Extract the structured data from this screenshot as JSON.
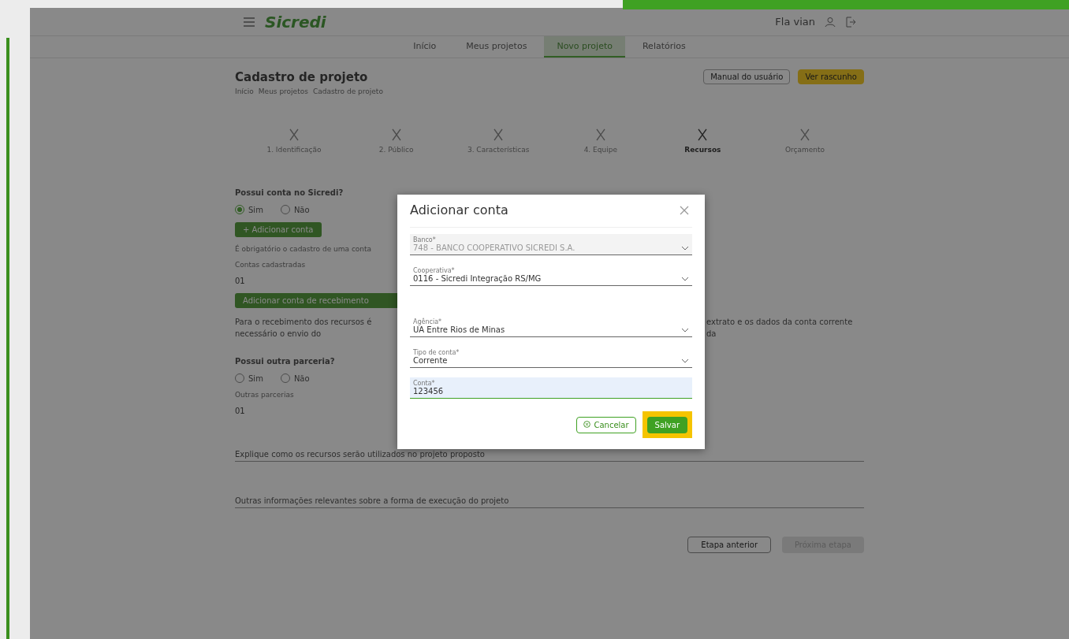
{
  "header": {
    "logo": "Sicredi",
    "user": "Fla vian"
  },
  "nav": [
    {
      "label": "Início",
      "selected": false
    },
    {
      "label": "Meus projetos",
      "selected": false
    },
    {
      "label": "Novo projeto",
      "selected": true
    },
    {
      "label": "Relatórios",
      "selected": false
    }
  ],
  "page": {
    "title": "Cadastro de projeto",
    "breadcrumb": [
      "Início",
      "Meus projetos",
      "Cadastro de projeto"
    ],
    "actions": [
      {
        "label": "Manual do usuário",
        "kind": "outline"
      },
      {
        "label": "Ver rascunho",
        "kind": "highlight"
      }
    ]
  },
  "steps": [
    {
      "label": "1. Identificação",
      "selected": false
    },
    {
      "label": "2. Público",
      "selected": false
    },
    {
      "label": "3. Características",
      "selected": false
    },
    {
      "label": "4. Equipe",
      "selected": false
    },
    {
      "label": "Recursos",
      "selected": true
    },
    {
      "label": "Orçamento",
      "selected": false
    }
  ],
  "form": {
    "question_1": "Possui conta no Sicredi?",
    "radios_1": [
      {
        "label": "Sim",
        "selected": true
      },
      {
        "label": "Não",
        "selected": false
      }
    ],
    "add_button": "+ Adicionar conta",
    "note": "É obrigatório o cadastro de uma conta",
    "field_1": {
      "label": "Contas cadastradas",
      "value": "01"
    },
    "receive_button": "Adicionar conta de recebimento",
    "paragraph": "Para o recebimento dos recursos é necessário o envio do",
    "paragraph_right": "extrato e os dados da conta corrente da",
    "question_2": "Possui outra parceria?",
    "radios_2": [
      {
        "label": "Sim",
        "selected": false
      },
      {
        "label": "Não",
        "selected": false
      }
    ],
    "field_2": {
      "label": "Outras parcerias",
      "value": "01"
    },
    "textarea_1": "Explique como os recursos serão utilizados no projeto proposto",
    "textarea_2": "Outras informações relevantes sobre a forma de execução do projeto",
    "back_button": "Etapa anterior",
    "next_button": {
      "label": "Próxima etapa",
      "disabled": true
    }
  },
  "modal": {
    "title": "Adicionar conta",
    "fields": [
      {
        "kind": "select",
        "label": "Banco*",
        "value": "748 - BANCO COOPERATIVO SICREDI S.A.",
        "disabled": true,
        "focused": false
      },
      {
        "kind": "select",
        "label": "Cooperativa*",
        "value": "0116 - Sicredi Integração RS/MG",
        "disabled": false,
        "focused": false
      },
      {
        "kind": "select",
        "label": "Agência*",
        "value": "UA Entre Rios de Minas",
        "disabled": false,
        "focused": false
      },
      {
        "kind": "select",
        "label": "Tipo de conta*",
        "value": "Corrente",
        "disabled": false,
        "focused": false
      },
      {
        "kind": "input",
        "label": "Conta*",
        "value": "123456",
        "disabled": false,
        "focused": true
      }
    ],
    "cancel": "Cancelar",
    "save": {
      "label": "Salvar",
      "highlighted": true
    }
  }
}
